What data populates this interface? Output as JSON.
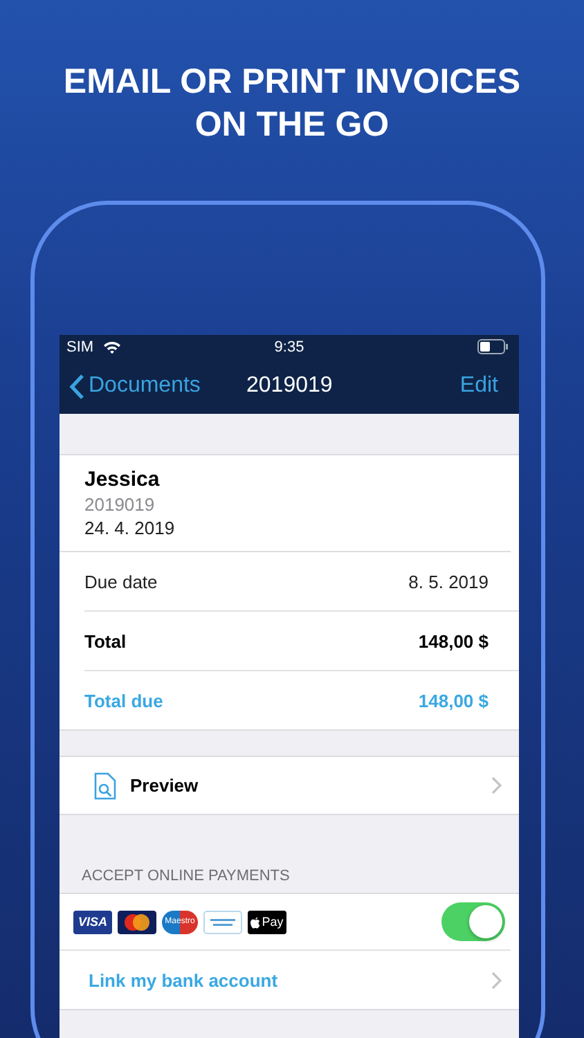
{
  "headline": [
    "EMAIL OR PRINT INVOICES",
    "ON THE GO"
  ],
  "status_bar": {
    "carrier": "SIM",
    "time": "9:35"
  },
  "nav": {
    "back": "Documents",
    "title": "2019019",
    "action": "Edit"
  },
  "invoice": {
    "client": "Jessica",
    "number": "2019019",
    "date": "24. 4. 2019"
  },
  "rows": [
    {
      "kind": "plain",
      "label": "Due date",
      "value": "8. 5. 2019"
    },
    {
      "kind": "bold",
      "label": "Total",
      "value": "148,00 $"
    },
    {
      "kind": "accent",
      "label": "Total due",
      "value": "148,00 $"
    }
  ],
  "preview": {
    "label": "Preview"
  },
  "payments": {
    "header": "ACCEPT ONLINE PAYMENTS",
    "on": true,
    "methods": [
      {
        "kind": "visa",
        "label": "VISA"
      },
      {
        "kind": "mastercard"
      },
      {
        "kind": "maestro",
        "label": "Maestro"
      },
      {
        "kind": "amex"
      },
      {
        "kind": "applepay",
        "label": "Pay"
      }
    ],
    "link": "Link my bank account"
  }
}
